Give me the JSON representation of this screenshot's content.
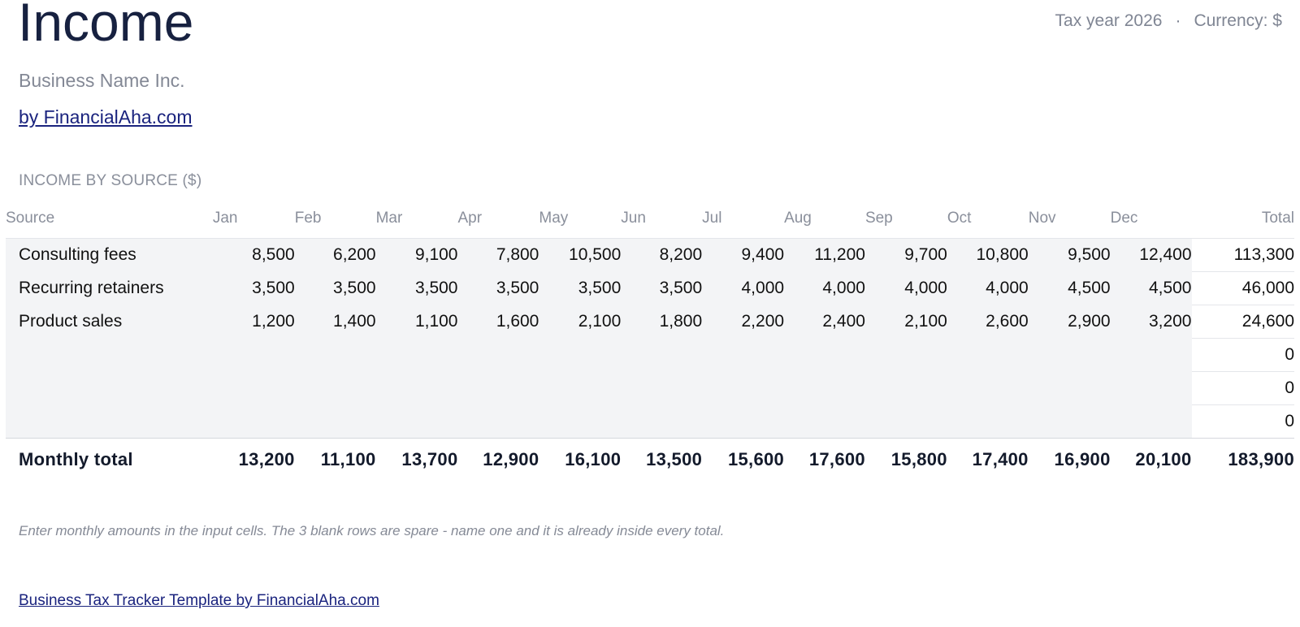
{
  "header": {
    "title": "Income",
    "tax_year": "Tax year 2026",
    "separator": "·",
    "currency": "Currency: $",
    "business_name": "Business Name Inc.",
    "by_link": "by FinancialAha.com"
  },
  "section": {
    "label": "INCOME BY SOURCE ($)"
  },
  "table": {
    "columns": [
      "Source",
      "Jan",
      "Feb",
      "Mar",
      "Apr",
      "May",
      "Jun",
      "Jul",
      "Aug",
      "Sep",
      "Oct",
      "Nov",
      "Dec",
      "Total"
    ],
    "rows": [
      {
        "source": "Consulting fees",
        "values": [
          "8,500",
          "6,200",
          "9,100",
          "7,800",
          "10,500",
          "8,200",
          "9,400",
          "11,200",
          "9,700",
          "10,800",
          "9,500",
          "12,400"
        ],
        "total": "113,300"
      },
      {
        "source": "Recurring retainers",
        "values": [
          "3,500",
          "3,500",
          "3,500",
          "3,500",
          "3,500",
          "3,500",
          "4,000",
          "4,000",
          "4,000",
          "4,000",
          "4,500",
          "4,500"
        ],
        "total": "46,000"
      },
      {
        "source": "Product sales",
        "values": [
          "1,200",
          "1,400",
          "1,100",
          "1,600",
          "2,100",
          "1,800",
          "2,200",
          "2,400",
          "2,100",
          "2,600",
          "2,900",
          "3,200"
        ],
        "total": "24,600"
      },
      {
        "source": "",
        "values": [
          "",
          "",
          "",
          "",
          "",
          "",
          "",
          "",
          "",
          "",
          "",
          ""
        ],
        "total": "0"
      },
      {
        "source": "",
        "values": [
          "",
          "",
          "",
          "",
          "",
          "",
          "",
          "",
          "",
          "",
          "",
          ""
        ],
        "total": "0"
      },
      {
        "source": "",
        "values": [
          "",
          "",
          "",
          "",
          "",
          "",
          "",
          "",
          "",
          "",
          "",
          ""
        ],
        "total": "0"
      }
    ],
    "footer": {
      "label": "Monthly total",
      "values": [
        "13,200",
        "11,100",
        "13,700",
        "12,900",
        "16,100",
        "13,500",
        "15,600",
        "17,600",
        "15,800",
        "17,400",
        "16,900",
        "20,100"
      ],
      "total": "183,900"
    }
  },
  "note": "Enter monthly amounts in the input cells. The 3 blank rows are spare - name one and it is already inside every total.",
  "footer_link": "Business Tax Tracker Template by FinancialAha.com",
  "colors": {
    "title": "#172140",
    "muted": "#838895",
    "link": "#1a237e",
    "input_fill": "#f3f4f6"
  }
}
